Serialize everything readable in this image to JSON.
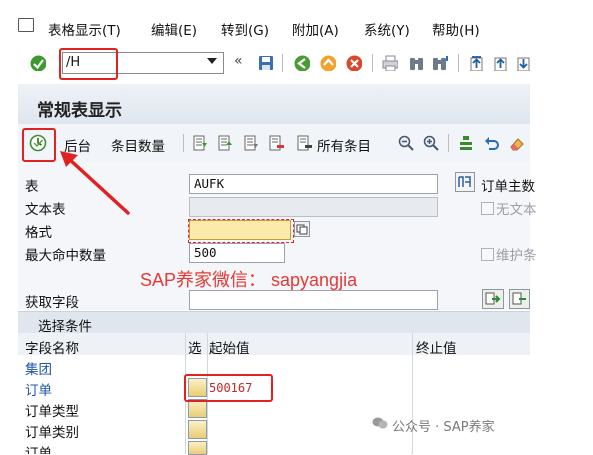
{
  "menu": {
    "items": [
      "表格显示(T)",
      "编辑(E)",
      "转到(G)",
      "附加(A)",
      "系统(Y)",
      "帮助(H)"
    ]
  },
  "toolbar": {
    "command_value": "/H"
  },
  "screen": {
    "title": "常规表显示"
  },
  "app_toolbar": {
    "background_label": "后台",
    "count_label": "条目数量",
    "all_entries_label": "所有条目"
  },
  "form": {
    "table_label": "表",
    "table_value": "AUFK",
    "text_table_label": "文本表",
    "format_label": "格式",
    "max_hits_label": "最大命中数量",
    "max_hits_value": "500",
    "fetch_fields_label": "获取字段",
    "order_master_label": "订单主数",
    "no_text_label": "无文本",
    "maintain_label": "维护条"
  },
  "selection": {
    "section_title": "选择条件",
    "col_field": "字段名称",
    "col_select": "选",
    "col_from": "起始值",
    "col_to": "终止值",
    "rows": [
      {
        "field": "集团",
        "from": ""
      },
      {
        "field": "订单",
        "from": "500167"
      },
      {
        "field": "订单类型",
        "from": ""
      },
      {
        "field": "订单类别",
        "from": ""
      },
      {
        "field": "订单",
        "from": ""
      }
    ]
  },
  "overlay": {
    "watermark": "SAP养家微信：  sapyangjia",
    "wechat": "公众号 · SAP养家"
  },
  "colors": {
    "accent_red": "#e12222",
    "title_bg": "#dfe6ee"
  }
}
